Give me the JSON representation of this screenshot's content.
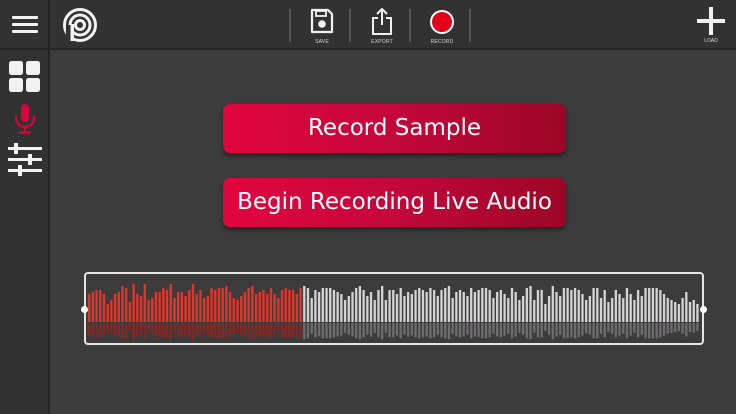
{
  "toolbar": {
    "menu_icon": "hamburger-menu-icon",
    "logo_icon": "app-logo-icon",
    "save_label": "SAVE",
    "export_label": "EXPORT",
    "record_label": "RECORD",
    "load_label": "LOAD"
  },
  "sidebar": {
    "items": [
      {
        "icon": "grid-icon",
        "active": false
      },
      {
        "icon": "microphone-icon",
        "active": true
      },
      {
        "icon": "sliders-icon",
        "active": false
      }
    ]
  },
  "main": {
    "record_sample_label": "Record Sample",
    "live_audio_label": "Begin Recording Live Audio"
  },
  "colors": {
    "accent": "#d9043c",
    "accent_dark": "#9b0626",
    "record_dot": "#e2001a",
    "played_bar": "#e2362b",
    "unplayed_bar": "#d4d4d4",
    "background": "#3d3c3d",
    "panel": "#333233"
  },
  "waveform": {
    "played_fraction": 0.35,
    "levels": [
      0.7,
      0.75,
      0.8,
      0.8,
      0.7,
      0.45,
      0.55,
      0.7,
      0.75,
      0.9,
      0.85,
      0.5,
      0.95,
      0.7,
      0.65,
      0.95,
      0.55,
      0.6,
      0.75,
      0.75,
      0.85,
      0.8,
      0.95,
      0.6,
      0.75,
      0.75,
      0.65,
      0.8,
      0.95,
      0.7,
      0.8,
      0.6,
      0.65,
      0.85,
      0.8,
      0.85,
      0.85,
      0.9,
      0.75,
      0.6,
      0.55,
      0.65,
      0.75,
      0.85,
      0.9,
      0.7,
      0.75,
      0.8,
      0.7,
      0.85,
      0.7,
      0.6,
      0.8,
      0.85,
      0.8,
      0.8,
      0.7,
      0.85,
      0.9,
      0.85,
      0.6,
      0.8,
      0.75,
      0.85,
      0.85,
      0.85,
      0.8,
      0.75,
      0.7,
      0.55,
      0.65,
      0.75,
      0.85,
      0.9,
      0.8,
      0.65,
      0.75,
      0.55,
      0.8,
      0.9,
      0.55,
      0.8,
      0.8,
      0.7,
      0.85,
      0.65,
      0.75,
      0.7,
      0.8,
      0.85,
      0.8,
      0.75,
      0.85,
      0.8,
      0.65,
      0.8,
      0.85,
      0.9,
      0.6,
      0.75,
      0.8,
      0.75,
      0.65,
      0.85,
      0.75,
      0.8,
      0.85,
      0.85,
      0.8,
      0.6,
      0.75,
      0.8,
      0.7,
      0.6,
      0.85,
      0.75,
      0.55,
      0.65,
      0.85,
      0.9,
      0.55,
      0.8,
      0.8,
      0.45,
      0.65,
      0.9,
      0.75,
      0.65,
      0.85,
      0.85,
      0.8,
      0.85,
      0.8,
      0.7,
      0.55,
      0.65,
      0.85,
      0.85,
      0.6,
      0.8,
      0.5,
      0.6,
      0.8,
      0.7,
      0.6,
      0.85,
      0.7,
      0.55,
      0.8,
      0.65,
      0.85,
      0.85,
      0.85,
      0.85,
      0.8,
      0.7,
      0.6,
      0.55,
      0.5,
      0.45,
      0.6,
      0.75,
      0.5,
      0.55,
      0.45
    ]
  }
}
